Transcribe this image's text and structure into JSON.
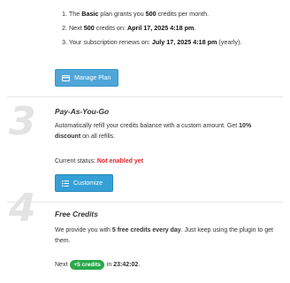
{
  "plan_info": {
    "line1": {
      "prefix": "1. The ",
      "plan": "Basic",
      "mid": " plan grants you ",
      "credits": "500",
      "suffix": " credits per month."
    },
    "line2": {
      "prefix": "2. Next ",
      "credits": "500",
      "mid": " credits on: ",
      "date": "April 17, 2025 4:18 pm",
      "suffix": "."
    },
    "line3": {
      "prefix": "3. Your subscription renews on: ",
      "date": "July 17, 2025 4:18 pm",
      "suffix": " (yearly)."
    }
  },
  "manage_button": {
    "label": "Manage Plan",
    "icon": "credit-card-icon"
  },
  "section3": {
    "number": "3",
    "title": "Pay-As-You-Go",
    "description_part1": "Automatically refill your credits balance with a custom amount. Get ",
    "description_bold": "10% discount",
    "description_part2": " on all refills.",
    "status_label": "Current status: ",
    "status_value": "Not enabled yet",
    "button_label": "Customize",
    "button_icon": "list-icon"
  },
  "section4": {
    "number": "4",
    "title": "Free Credits",
    "description_part1": "We provide you with ",
    "description_bold": "5 free credits every day",
    "description_part2": ". Just keep using the plugin to get them.",
    "next_label": "Next ",
    "badge_text": "+5 credits",
    "in_label": " in ",
    "countdown": "23:42:02",
    "end": "."
  },
  "colors": {
    "accent": "#34a0d5",
    "status_red": "#e2232a",
    "badge_green": "#2aa84a"
  }
}
